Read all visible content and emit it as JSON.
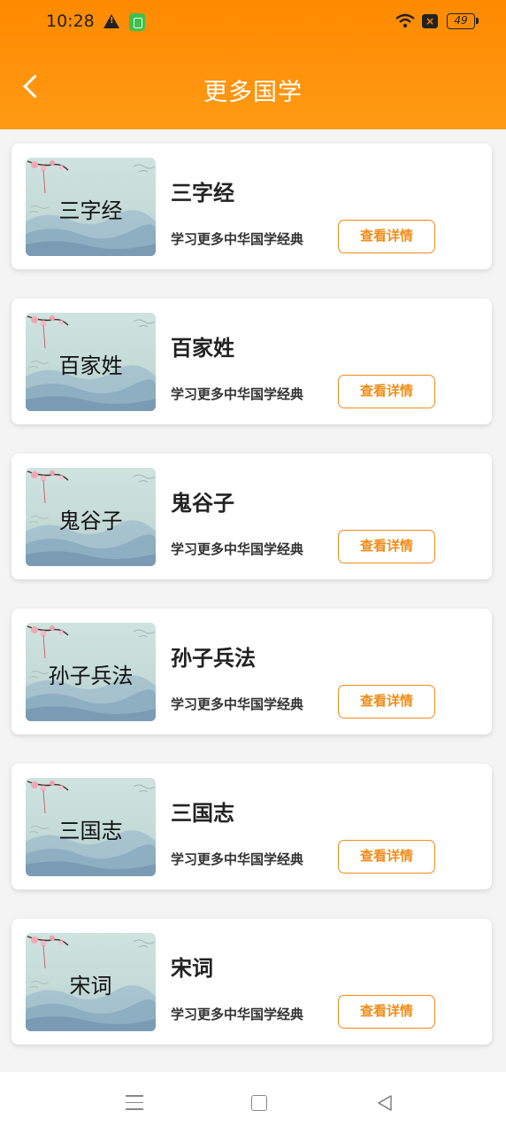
{
  "status": {
    "time": "10:28",
    "battery": "49"
  },
  "header": {
    "title": "更多国学"
  },
  "colors": {
    "accent": "#ff8a00",
    "button_border": "#f08c1a"
  },
  "items": [
    {
      "thumb_label": "三字经",
      "title": "三字经",
      "desc": "学习更多中华国学经典",
      "button": "查看详情"
    },
    {
      "thumb_label": "百家姓",
      "title": "百家姓",
      "desc": "学习更多中华国学经典",
      "button": "查看详情"
    },
    {
      "thumb_label": "鬼谷子",
      "title": "鬼谷子",
      "desc": "学习更多中华国学经典",
      "button": "查看详情"
    },
    {
      "thumb_label": "孙子兵法",
      "title": "孙子兵法",
      "desc": "学习更多中华国学经典",
      "button": "查看详情"
    },
    {
      "thumb_label": "三国志",
      "title": "三国志",
      "desc": "学习更多中华国学经典",
      "button": "查看详情"
    },
    {
      "thumb_label": "宋词",
      "title": "宋词",
      "desc": "学习更多中华国学经典",
      "button": "查看详情"
    }
  ],
  "icons": [
    "warning-icon",
    "app-badge-icon",
    "wifi-icon",
    "close-box-icon",
    "battery-icon",
    "back-arrow-icon",
    "menu-icon",
    "home-icon",
    "back-nav-icon"
  ]
}
